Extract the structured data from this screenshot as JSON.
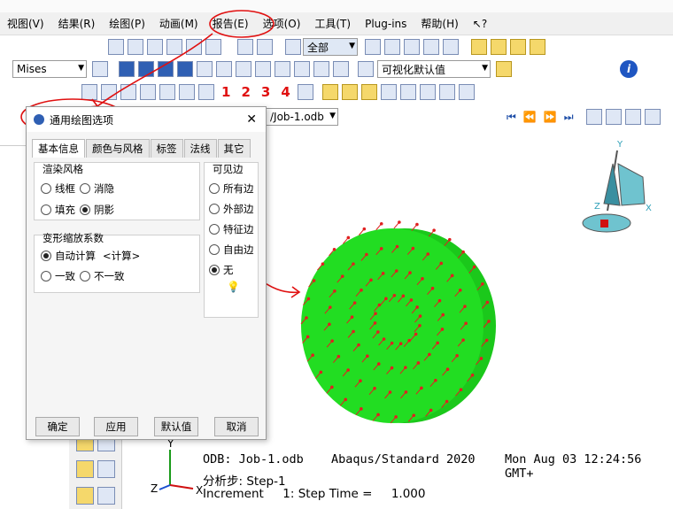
{
  "menu": [
    "视图(V)",
    "结果(R)",
    "绘图(P)",
    "动画(M)",
    "报告(E)",
    "选项(O)",
    "工具(T)",
    "Plug-ins",
    "帮助(H)",
    "↖?"
  ],
  "toolbar": {
    "all_label": "全部",
    "field_label": "Mises",
    "default_label": "可视化默认值",
    "step_nums": [
      "1",
      "2",
      "3",
      "4"
    ]
  },
  "viewport": {
    "odb_combo": "/Job-1.odb"
  },
  "dialog": {
    "title": "通用绘图选项",
    "tabs": [
      "基本信息",
      "颜色与风格",
      "标签",
      "法线",
      "其它"
    ],
    "render_style": {
      "title": "渲染风格",
      "options": [
        "线框",
        "消隐",
        "填充",
        "阴影"
      ]
    },
    "deform_scale": {
      "title": "变形缩放系数",
      "auto": "自动计算",
      "auto_hint": "<计算>",
      "uniform": "一致",
      "nonuniform": "不一致"
    },
    "visible_edges": {
      "title": "可见边",
      "options": [
        "所有边",
        "外部边",
        "特征边",
        "自由边",
        "无"
      ]
    },
    "buttons": [
      "确定",
      "应用",
      "默认值",
      "取消"
    ]
  },
  "status": {
    "odb": "ODB: Job-1.odb",
    "solver": "Abaqus/Standard 2020",
    "date": "Mon Aug 03 12:24:56 GMT+",
    "step": "分析步: Step-1",
    "increment": "Increment     1: Step Time =     1.000"
  },
  "triad": {
    "x": "X",
    "y": "Y",
    "z": "Z"
  },
  "colors": {
    "sphere": "#22dd22",
    "arrows": "#e02020",
    "annotation": "#e01010"
  }
}
